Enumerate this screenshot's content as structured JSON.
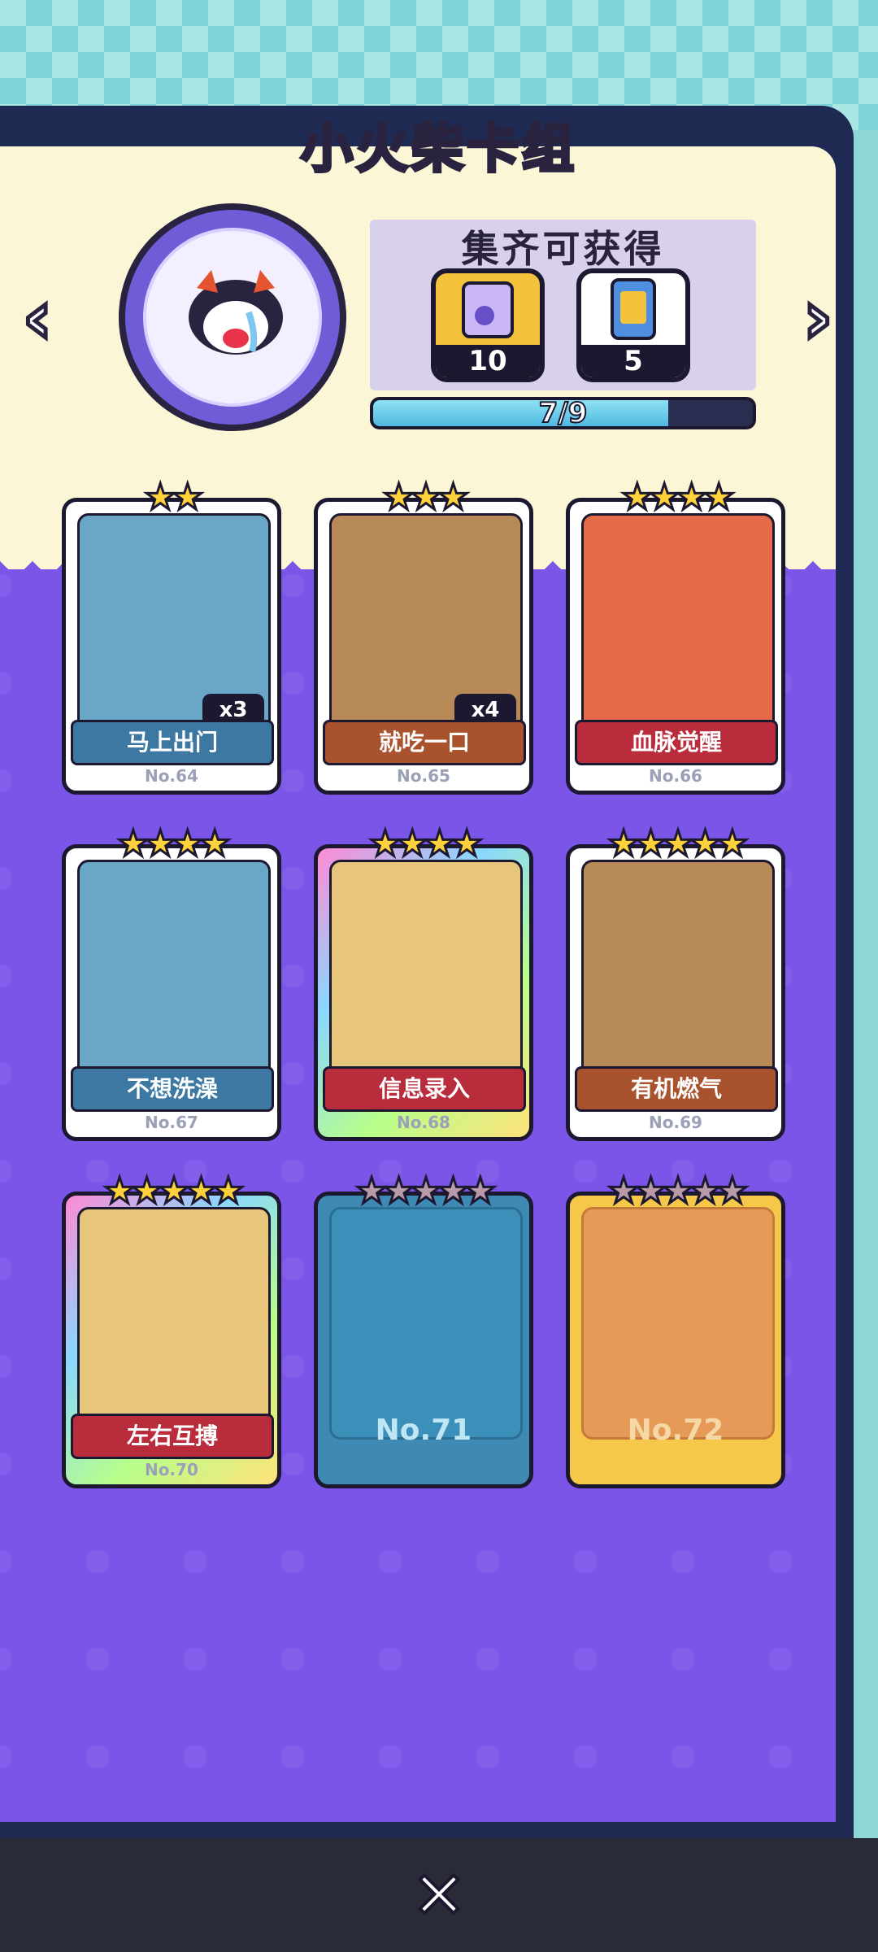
{
  "title": "小火柴卡组",
  "reward": {
    "heading": "集齐可获得",
    "items": [
      {
        "name": "dice-box",
        "count": "10"
      },
      {
        "name": "card-pack",
        "count": "5"
      }
    ],
    "progress_text": "7/9",
    "progress_fraction": 0.778
  },
  "nav": {
    "left": "‹",
    "right": "›"
  },
  "cards": [
    {
      "name": "马上出门",
      "number": "No.64",
      "stars": "★★",
      "dup": "x3"
    },
    {
      "name": "就吃一口",
      "number": "No.65",
      "stars": "★★★",
      "dup": "x4"
    },
    {
      "name": "血脉觉醒",
      "number": "No.66",
      "stars": "★★★★"
    },
    {
      "name": "不想洗澡",
      "number": "No.67",
      "stars": "★★★★"
    },
    {
      "name": "信息录入",
      "number": "No.68",
      "stars": "★★★★"
    },
    {
      "name": "有机燃气",
      "number": "No.69",
      "stars": "★★★★★"
    },
    {
      "name": "左右互搏",
      "number": "No.70",
      "stars": "★★★★★"
    },
    {
      "number": "No.71",
      "stars": "★★★★★"
    },
    {
      "number": "No.72",
      "stars": "★★★★★"
    }
  ],
  "close": "✕"
}
